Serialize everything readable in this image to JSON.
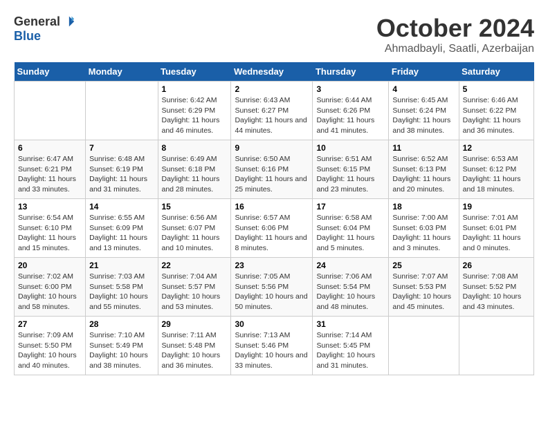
{
  "header": {
    "logo_general": "General",
    "logo_blue": "Blue",
    "title": "October 2024",
    "location": "Ahmadbayli, Saatli, Azerbaijan"
  },
  "weekdays": [
    "Sunday",
    "Monday",
    "Tuesday",
    "Wednesday",
    "Thursday",
    "Friday",
    "Saturday"
  ],
  "weeks": [
    [
      {
        "day": "",
        "info": ""
      },
      {
        "day": "",
        "info": ""
      },
      {
        "day": "1",
        "info": "Sunrise: 6:42 AM\nSunset: 6:29 PM\nDaylight: 11 hours and 46 minutes."
      },
      {
        "day": "2",
        "info": "Sunrise: 6:43 AM\nSunset: 6:27 PM\nDaylight: 11 hours and 44 minutes."
      },
      {
        "day": "3",
        "info": "Sunrise: 6:44 AM\nSunset: 6:26 PM\nDaylight: 11 hours and 41 minutes."
      },
      {
        "day": "4",
        "info": "Sunrise: 6:45 AM\nSunset: 6:24 PM\nDaylight: 11 hours and 38 minutes."
      },
      {
        "day": "5",
        "info": "Sunrise: 6:46 AM\nSunset: 6:22 PM\nDaylight: 11 hours and 36 minutes."
      }
    ],
    [
      {
        "day": "6",
        "info": "Sunrise: 6:47 AM\nSunset: 6:21 PM\nDaylight: 11 hours and 33 minutes."
      },
      {
        "day": "7",
        "info": "Sunrise: 6:48 AM\nSunset: 6:19 PM\nDaylight: 11 hours and 31 minutes."
      },
      {
        "day": "8",
        "info": "Sunrise: 6:49 AM\nSunset: 6:18 PM\nDaylight: 11 hours and 28 minutes."
      },
      {
        "day": "9",
        "info": "Sunrise: 6:50 AM\nSunset: 6:16 PM\nDaylight: 11 hours and 25 minutes."
      },
      {
        "day": "10",
        "info": "Sunrise: 6:51 AM\nSunset: 6:15 PM\nDaylight: 11 hours and 23 minutes."
      },
      {
        "day": "11",
        "info": "Sunrise: 6:52 AM\nSunset: 6:13 PM\nDaylight: 11 hours and 20 minutes."
      },
      {
        "day": "12",
        "info": "Sunrise: 6:53 AM\nSunset: 6:12 PM\nDaylight: 11 hours and 18 minutes."
      }
    ],
    [
      {
        "day": "13",
        "info": "Sunrise: 6:54 AM\nSunset: 6:10 PM\nDaylight: 11 hours and 15 minutes."
      },
      {
        "day": "14",
        "info": "Sunrise: 6:55 AM\nSunset: 6:09 PM\nDaylight: 11 hours and 13 minutes."
      },
      {
        "day": "15",
        "info": "Sunrise: 6:56 AM\nSunset: 6:07 PM\nDaylight: 11 hours and 10 minutes."
      },
      {
        "day": "16",
        "info": "Sunrise: 6:57 AM\nSunset: 6:06 PM\nDaylight: 11 hours and 8 minutes."
      },
      {
        "day": "17",
        "info": "Sunrise: 6:58 AM\nSunset: 6:04 PM\nDaylight: 11 hours and 5 minutes."
      },
      {
        "day": "18",
        "info": "Sunrise: 7:00 AM\nSunset: 6:03 PM\nDaylight: 11 hours and 3 minutes."
      },
      {
        "day": "19",
        "info": "Sunrise: 7:01 AM\nSunset: 6:01 PM\nDaylight: 11 hours and 0 minutes."
      }
    ],
    [
      {
        "day": "20",
        "info": "Sunrise: 7:02 AM\nSunset: 6:00 PM\nDaylight: 10 hours and 58 minutes."
      },
      {
        "day": "21",
        "info": "Sunrise: 7:03 AM\nSunset: 5:58 PM\nDaylight: 10 hours and 55 minutes."
      },
      {
        "day": "22",
        "info": "Sunrise: 7:04 AM\nSunset: 5:57 PM\nDaylight: 10 hours and 53 minutes."
      },
      {
        "day": "23",
        "info": "Sunrise: 7:05 AM\nSunset: 5:56 PM\nDaylight: 10 hours and 50 minutes."
      },
      {
        "day": "24",
        "info": "Sunrise: 7:06 AM\nSunset: 5:54 PM\nDaylight: 10 hours and 48 minutes."
      },
      {
        "day": "25",
        "info": "Sunrise: 7:07 AM\nSunset: 5:53 PM\nDaylight: 10 hours and 45 minutes."
      },
      {
        "day": "26",
        "info": "Sunrise: 7:08 AM\nSunset: 5:52 PM\nDaylight: 10 hours and 43 minutes."
      }
    ],
    [
      {
        "day": "27",
        "info": "Sunrise: 7:09 AM\nSunset: 5:50 PM\nDaylight: 10 hours and 40 minutes."
      },
      {
        "day": "28",
        "info": "Sunrise: 7:10 AM\nSunset: 5:49 PM\nDaylight: 10 hours and 38 minutes."
      },
      {
        "day": "29",
        "info": "Sunrise: 7:11 AM\nSunset: 5:48 PM\nDaylight: 10 hours and 36 minutes."
      },
      {
        "day": "30",
        "info": "Sunrise: 7:13 AM\nSunset: 5:46 PM\nDaylight: 10 hours and 33 minutes."
      },
      {
        "day": "31",
        "info": "Sunrise: 7:14 AM\nSunset: 5:45 PM\nDaylight: 10 hours and 31 minutes."
      },
      {
        "day": "",
        "info": ""
      },
      {
        "day": "",
        "info": ""
      }
    ]
  ]
}
